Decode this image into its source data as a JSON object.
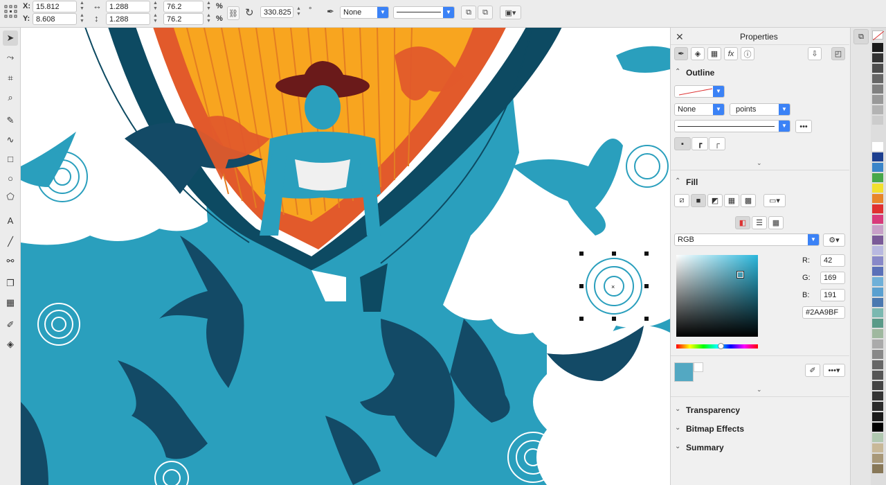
{
  "toolbar": {
    "x_label": "X:",
    "x_value": "15.812",
    "y_label": "Y:",
    "y_value": "8.608",
    "w_value": "1.288",
    "h_value": "1.288",
    "scale_w": "76.2",
    "scale_h": "76.2",
    "percent": "%",
    "rotation": "330.825",
    "degree": "°",
    "outline_width": "None"
  },
  "panel": {
    "title": "Properties",
    "outline": {
      "title": "Outline",
      "width": "None",
      "units": "points"
    },
    "fill": {
      "title": "Fill",
      "color_model": "RGB",
      "r_label": "R:",
      "r": "42",
      "g_label": "G:",
      "g": "169",
      "b_label": "B:",
      "b": "191",
      "hex": "#2AA9BF"
    },
    "sections": [
      "Transparency",
      "Bitmap Effects",
      "Summary"
    ]
  },
  "colors": {
    "fill_color": "#2AA9BF",
    "accent": "#3b82f6"
  },
  "palette": [
    "#ffffff",
    "#1d3f8f",
    "#3a85c9",
    "#47a84a",
    "#f2e02e",
    "#e8862a",
    "#e03030",
    "#d83a7a",
    "#c8a0c8",
    "#7a5a98",
    "#b8b8e0",
    "#8888c8",
    "#5a70b8",
    "#6fb0d8",
    "#5aa0d0",
    "#4a78b0",
    "#7ab8b0",
    "#5a9a88",
    "#9fb89f",
    "#aaaaaa",
    "#888888",
    "#666666",
    "#555555",
    "#444444",
    "#333333",
    "#2a2a2a",
    "#1a1a1a",
    "#000000",
    "#b0c8b0",
    "#c8b898",
    "#a89878",
    "#887858"
  ]
}
